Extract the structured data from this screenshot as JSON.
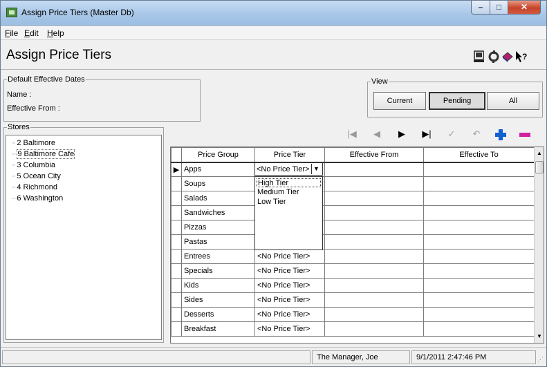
{
  "window": {
    "title": "Assign Price Tiers (Master Db)"
  },
  "menu": {
    "items": [
      "File",
      "Edit",
      "Help"
    ]
  },
  "header": {
    "title": "Assign Price Tiers"
  },
  "default_dates": {
    "legend": "Default Effective Dates",
    "name_label": "Name :",
    "from_label": "Effective From :"
  },
  "view": {
    "legend": "View",
    "buttons": [
      "Current",
      "Pending",
      "All"
    ],
    "selected": "Pending"
  },
  "stores": {
    "legend": "Stores",
    "items": [
      "2 Baltimore",
      "9 Baltimore Cafe",
      "3 Columbia",
      "5 Ocean City",
      "4 Richmond",
      "6 Washington"
    ],
    "selected": "9 Baltimore Cafe"
  },
  "grid": {
    "columns": [
      "Price Group",
      "Price Tier",
      "Effective From",
      "Effective To"
    ],
    "rows": [
      {
        "group": "Apps",
        "tier": ""
      },
      {
        "group": "Soups",
        "tier": ""
      },
      {
        "group": "Salads",
        "tier": ""
      },
      {
        "group": "Sandwiches",
        "tier": ""
      },
      {
        "group": "Pizzas",
        "tier": ""
      },
      {
        "group": "Pastas",
        "tier": ""
      },
      {
        "group": "Entrees",
        "tier": "<No Price Tier>"
      },
      {
        "group": "Specials",
        "tier": "<No Price Tier>"
      },
      {
        "group": "Kids",
        "tier": "<No Price Tier>"
      },
      {
        "group": "Sides",
        "tier": "<No Price Tier>"
      },
      {
        "group": "Desserts",
        "tier": "<No Price Tier>"
      },
      {
        "group": "Breakfast",
        "tier": "<No Price Tier>"
      }
    ]
  },
  "editor": {
    "value": "<No Price Tier>",
    "options": [
      "High Tier",
      "Medium Tier",
      "Low Tier"
    ]
  },
  "status": {
    "user": "The Manager, Joe",
    "datetime": "9/1/2011 2:47:46 PM"
  },
  "colors": {
    "accent_blue": "#1060d0",
    "delete_magenta": "#d020a0",
    "titlebar": "#a9c7e8"
  }
}
